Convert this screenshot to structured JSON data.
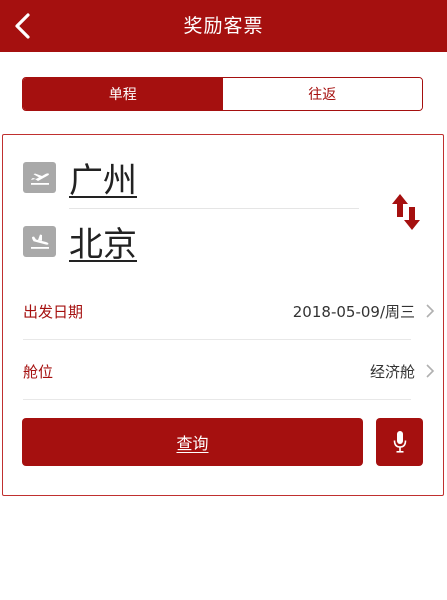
{
  "header": {
    "title": "奖励客票",
    "back_icon": "chevron-left-icon",
    "background": "#a5100f"
  },
  "trip_type": {
    "options": [
      "单程",
      "往返"
    ],
    "selected": "单程"
  },
  "route": {
    "departure_city": "广州",
    "departure_icon": "plane-takeoff-icon",
    "arrival_city": "北京",
    "arrival_icon": "plane-landing-icon",
    "swap_icon": "swap-arrows-icon"
  },
  "date_row": {
    "label": "出发日期",
    "value": "2018-05-09/周三"
  },
  "cabin_row": {
    "label": "舱位",
    "value": "经济舱"
  },
  "actions": {
    "search_label": "查询",
    "mic_icon": "microphone-icon"
  },
  "colors": {
    "accent": "#a5100f",
    "icon_gray": "#a9a9a9"
  }
}
